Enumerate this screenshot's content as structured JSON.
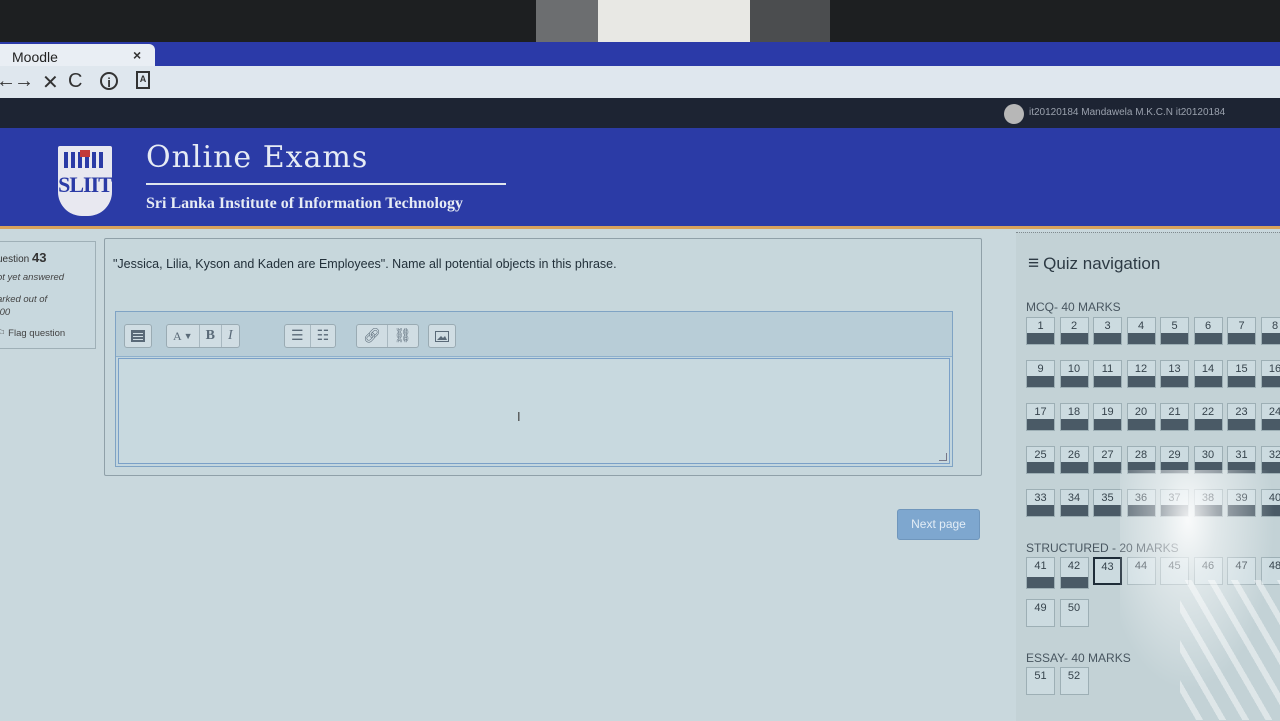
{
  "browser": {
    "tab_title": "Moodle",
    "tab_close": "×",
    "nav_back": "←",
    "nav_forward": "→",
    "nav_stop": "✕",
    "nav_reload": "C",
    "info_icon": "i"
  },
  "user": {
    "name": "it20120184 Mandawela M.K.C.N it20120184"
  },
  "banner": {
    "logo_text": "SLIIT",
    "title": "Online Exams",
    "subtitle": "Sri Lanka Institute of Information Technology"
  },
  "question": {
    "label": "uestion",
    "number": "43",
    "state": "ot yet answered",
    "marked_out_of": "arked out of",
    "marks": ".00",
    "flag": "Flag question",
    "text": "\"Jessica, Lilia, Kyson and Kaden are Employees\". Name all potential objects in this phrase.",
    "editor": {
      "b": "B",
      "i": "I",
      "font_size": "A",
      "answer": ""
    }
  },
  "next_page": "Next page",
  "quiz_nav": {
    "title": "Quiz navigation",
    "sections": [
      {
        "title": "MCQ- 40 MARKS",
        "items": [
          "1",
          "2",
          "3",
          "4",
          "5",
          "6",
          "7",
          "8",
          "9",
          "10",
          "11",
          "12",
          "13",
          "14",
          "15",
          "16",
          "17",
          "18",
          "19",
          "20",
          "21",
          "22",
          "23",
          "24",
          "25",
          "26",
          "27",
          "28",
          "29",
          "30",
          "31",
          "32",
          "33",
          "34",
          "35",
          "36",
          "37",
          "38",
          "39",
          "40"
        ]
      },
      {
        "title": "STRUCTURED - 20 MARKS",
        "items": [
          "41",
          "42",
          "43",
          "44",
          "45",
          "46",
          "47",
          "48",
          "49",
          "50"
        ],
        "current": "43"
      },
      {
        "title": "ESSAY- 40 MARKS",
        "items": [
          "51",
          "52"
        ]
      }
    ]
  },
  "colors": {
    "banner": "#2b3ba6",
    "answered_fill": "#4a5a66",
    "next_button": "#7ea7cf"
  }
}
